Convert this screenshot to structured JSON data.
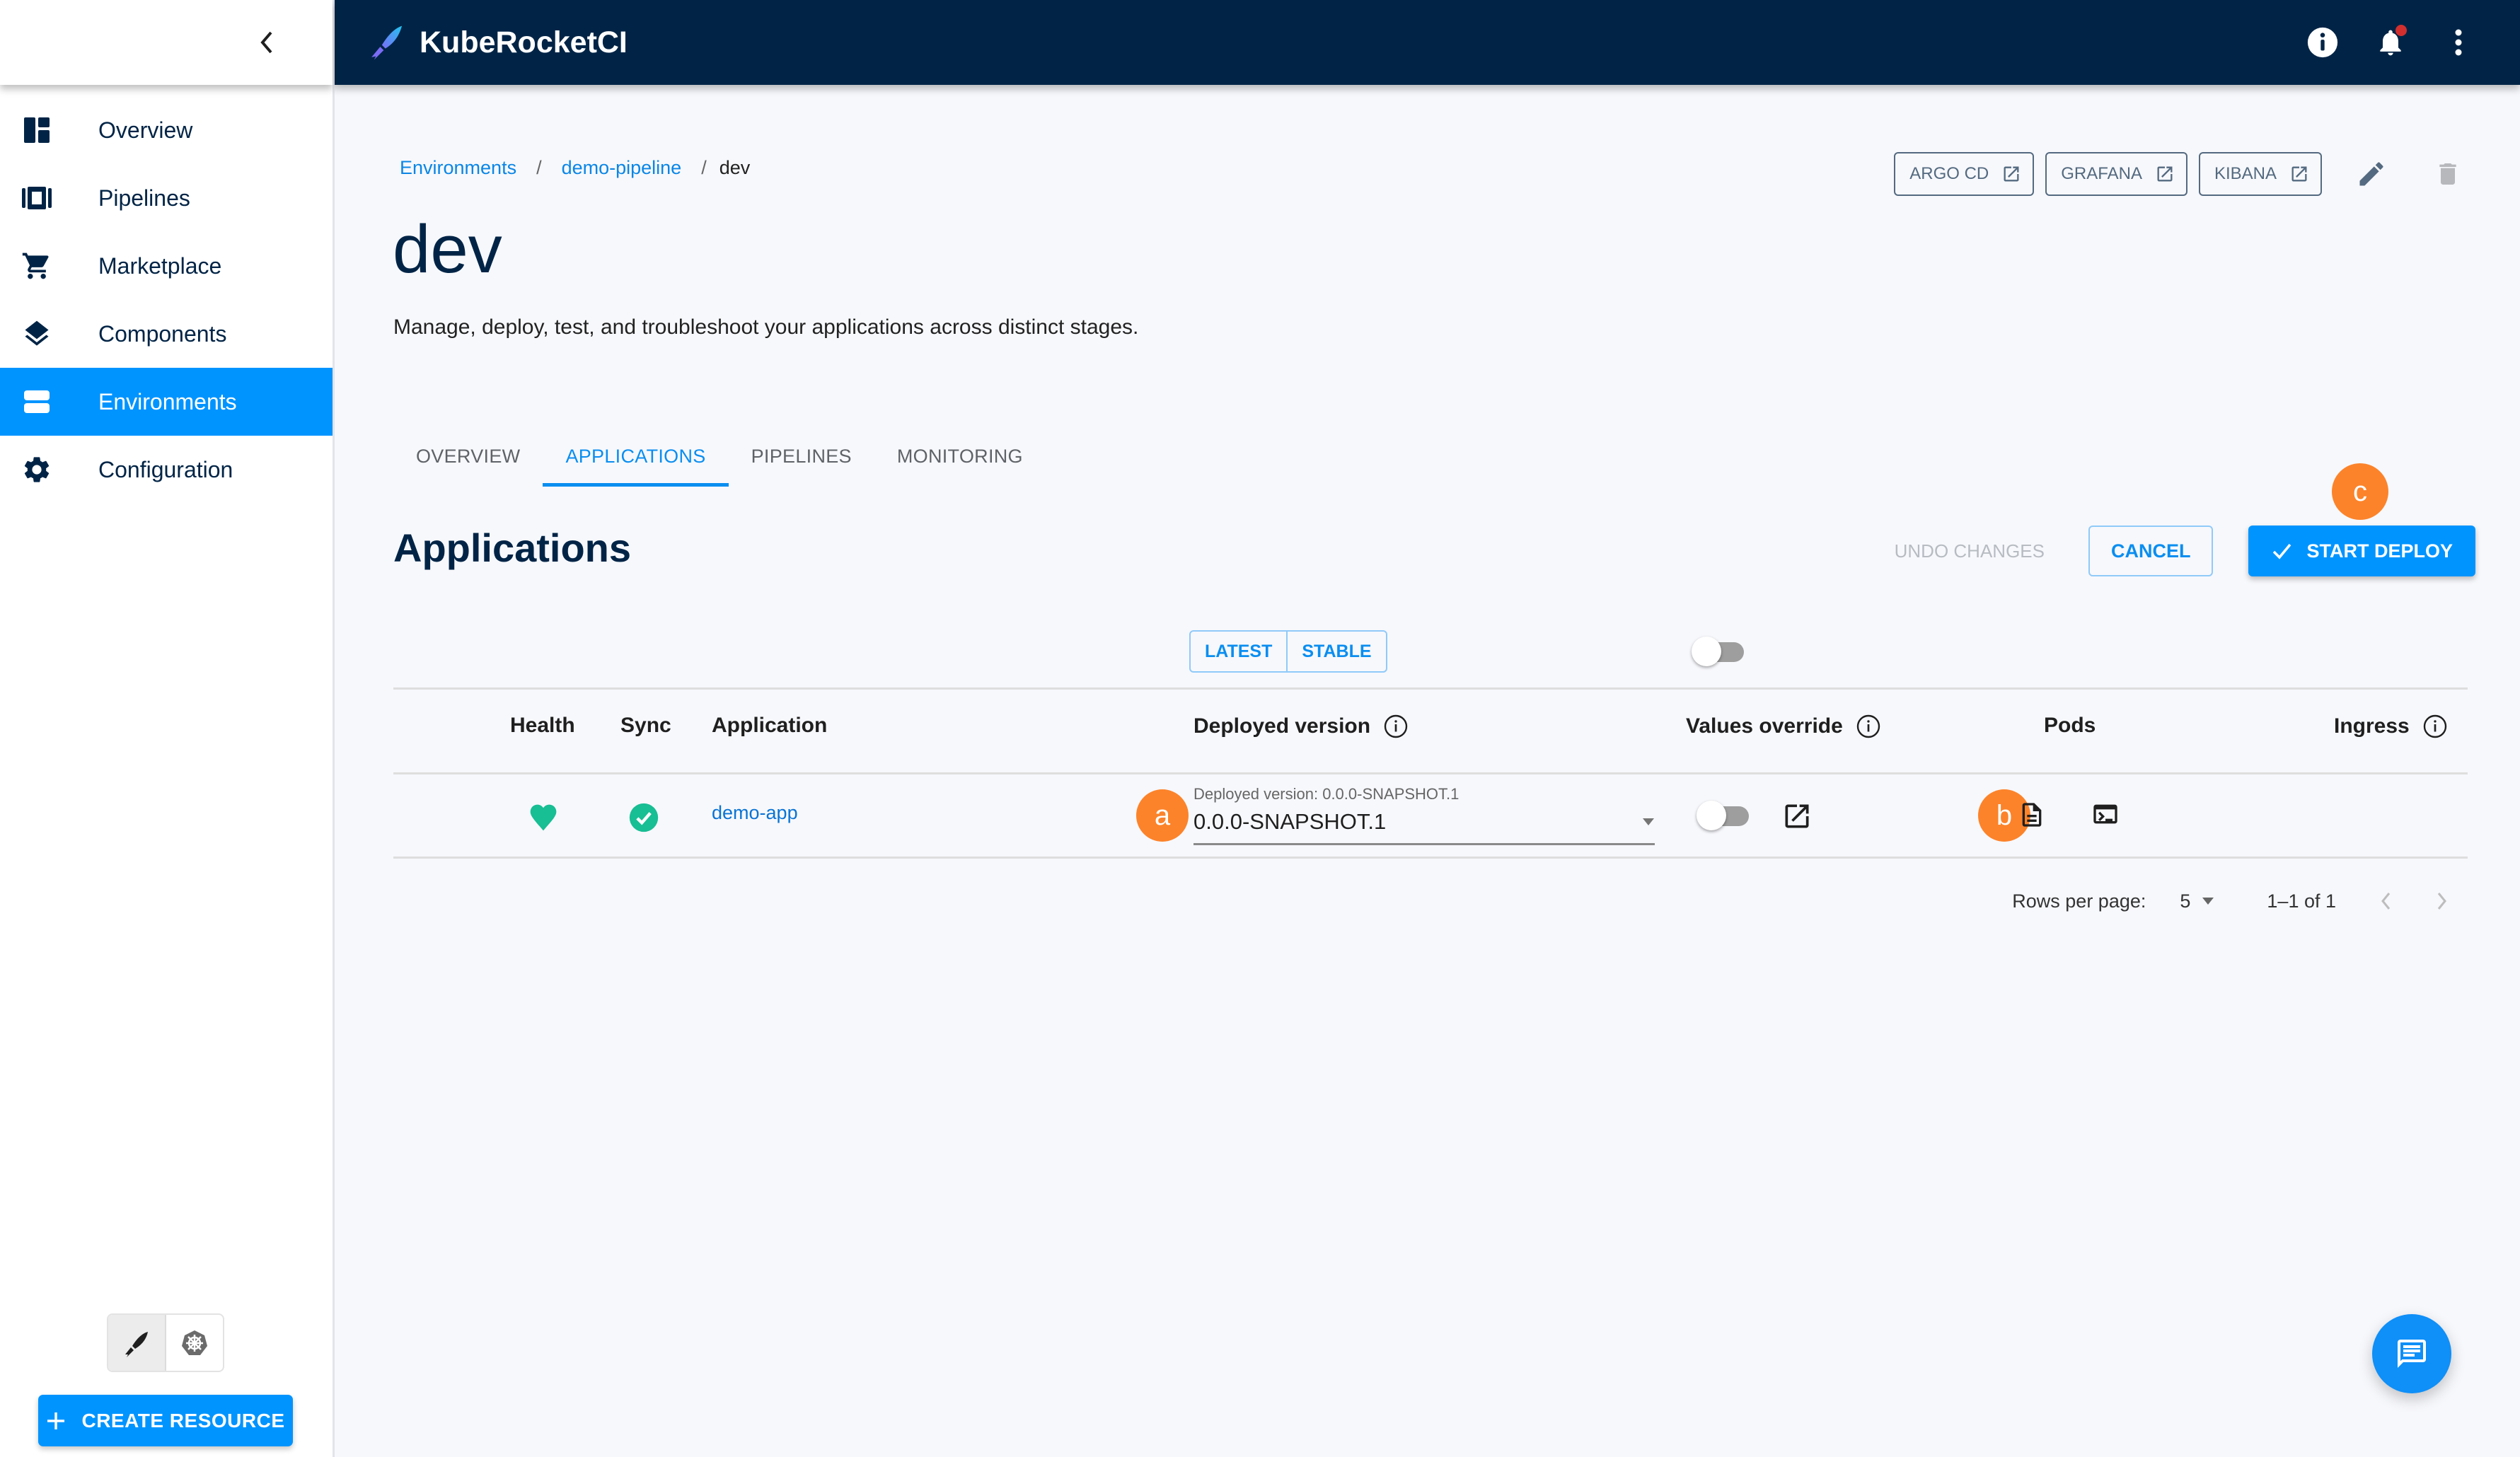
{
  "app": {
    "title": "KubeRocketCI"
  },
  "sidebar": {
    "items": [
      {
        "label": "Overview",
        "icon": "dashboard-icon",
        "active": false
      },
      {
        "label": "Pipelines",
        "icon": "pipelines-icon",
        "active": false
      },
      {
        "label": "Marketplace",
        "icon": "cart-icon",
        "active": false
      },
      {
        "label": "Components",
        "icon": "layers-icon",
        "active": false
      },
      {
        "label": "Environments",
        "icon": "environments-icon",
        "active": true
      },
      {
        "label": "Configuration",
        "icon": "gear-icon",
        "active": false
      }
    ],
    "mode_switch": [
      "krci-mode",
      "kubernetes-mode"
    ],
    "create_button": "CREATE RESOURCE"
  },
  "breadcrumb": {
    "items": [
      "Environments",
      "demo-pipeline"
    ],
    "current": "dev",
    "separator": "/"
  },
  "page": {
    "title": "dev",
    "description": "Manage, deploy, test, and troubleshoot your applications across distinct stages."
  },
  "header_links": [
    {
      "label": "ARGO CD"
    },
    {
      "label": "GRAFANA"
    },
    {
      "label": "KIBANA"
    }
  ],
  "tabs": [
    {
      "label": "OVERVIEW",
      "active": false
    },
    {
      "label": "APPLICATIONS",
      "active": true
    },
    {
      "label": "PIPELINES",
      "active": false
    },
    {
      "label": "MONITORING",
      "active": false
    }
  ],
  "section": {
    "title": "Applications",
    "undo_label": "UNDO CHANGES",
    "cancel_label": "CANCEL",
    "deploy_label": "START DEPLOY"
  },
  "version_toggle": {
    "options": [
      "LATEST",
      "STABLE"
    ]
  },
  "table": {
    "columns": {
      "health": "Health",
      "sync": "Sync",
      "application": "Application",
      "deployed_version": "Deployed version",
      "values_override": "Values override",
      "pods": "Pods",
      "ingress": "Ingress"
    },
    "rows": [
      {
        "health": "healthy",
        "sync": "synced",
        "application": "demo-app",
        "deployed_version_label": "Deployed version: 0.0.0-SNAPSHOT.1",
        "deployed_version_value": "0.0.0-SNAPSHOT.1",
        "values_override": false
      }
    ]
  },
  "pagination": {
    "rows_per_page_label": "Rows per page:",
    "rows_per_page": "5",
    "range": "1–1 of 1"
  },
  "markers": {
    "a": "a",
    "b": "b",
    "c": "c"
  },
  "colors": {
    "header_bg": "#012446",
    "accent": "#0094ff",
    "marker": "#fc832a",
    "healthy": "#18be94"
  }
}
